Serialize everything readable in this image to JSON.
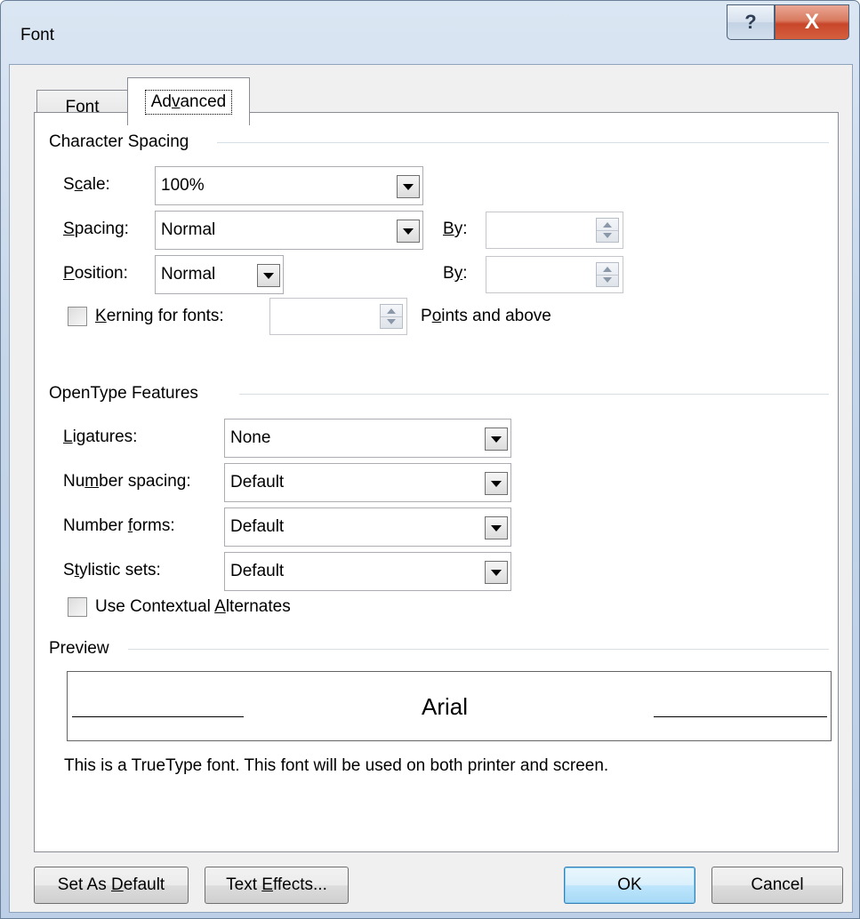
{
  "window": {
    "title": "Font",
    "help_glyph": "?",
    "close_glyph": "X"
  },
  "tabs": [
    {
      "label_pre": "Fo",
      "label_key": "n",
      "label_post": "t",
      "active": false
    },
    {
      "label_pre": "Ad",
      "label_key": "v",
      "label_post": "anced",
      "active": true
    }
  ],
  "character_spacing": {
    "title": "Character Spacing",
    "scale": {
      "label_pre": "S",
      "label_key": "c",
      "label_post": "ale:",
      "value": "100%"
    },
    "spacing": {
      "label_pre": "",
      "label_key": "S",
      "label_post": "pacing:",
      "value": "Normal",
      "by_label_pre": "",
      "by_label_key": "B",
      "by_label_post": "y:",
      "by_value": ""
    },
    "position": {
      "label_pre": "",
      "label_key": "P",
      "label_post": "osition:",
      "value": "Normal",
      "by_label_pre": "B",
      "by_label_key": "y",
      "by_label_post": ":",
      "by_value": ""
    },
    "kerning": {
      "checked": false,
      "label_pre": "",
      "label_key": "K",
      "label_post": "erning for fonts:",
      "value": "",
      "suffix_pre": "P",
      "suffix_key": "o",
      "suffix_post": "ints and above"
    }
  },
  "opentype": {
    "title": "OpenType Features",
    "ligatures": {
      "label_pre": "",
      "label_key": "L",
      "label_post": "igatures:",
      "value": "None"
    },
    "number_spacing": {
      "label_pre": "Nu",
      "label_key": "m",
      "label_post": "ber spacing:",
      "value": "Default"
    },
    "number_forms": {
      "label_pre": "Number ",
      "label_key": "f",
      "label_post": "orms:",
      "value": "Default"
    },
    "stylistic_sets": {
      "label_pre": "S",
      "label_key": "t",
      "label_post": "ylistic sets:",
      "value": "Default"
    },
    "contextual": {
      "checked": false,
      "label_pre": "Use Contextual ",
      "label_key": "A",
      "label_post": "lternates"
    }
  },
  "preview": {
    "title": "Preview",
    "sample": "Arial",
    "description": "This is a TrueType font. This font will be used on both printer and screen."
  },
  "buttons": {
    "set_default": {
      "pre": "Set As ",
      "key": "D",
      "post": "efault"
    },
    "text_effects": {
      "pre": "Text ",
      "key": "E",
      "post": "ffects..."
    },
    "ok": "OK",
    "cancel": "Cancel"
  }
}
